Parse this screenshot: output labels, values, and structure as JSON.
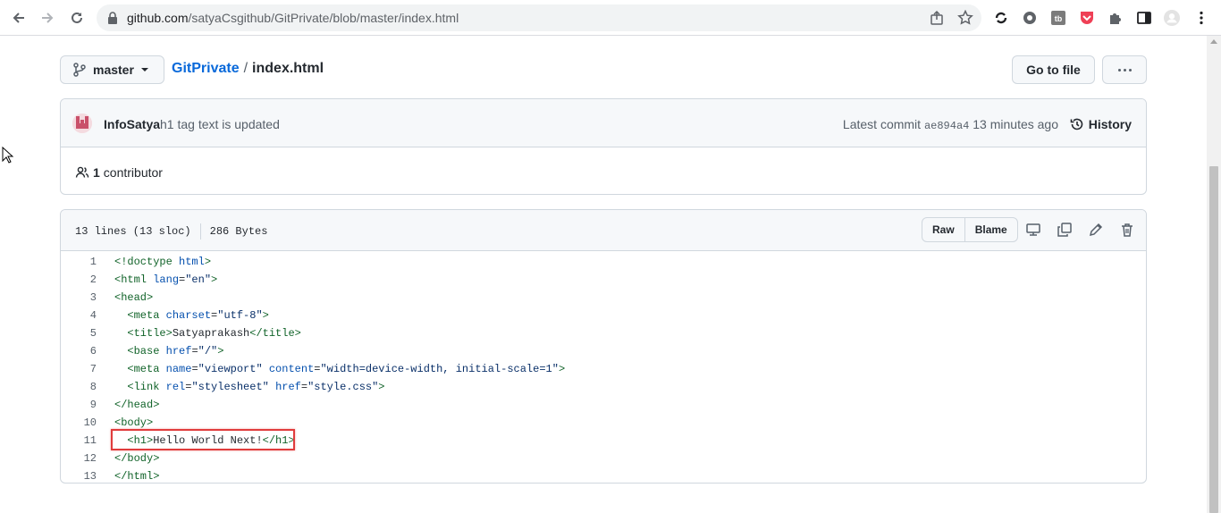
{
  "browser": {
    "url_host": "github.com",
    "url_path": "/satyaCsgithub/GitPrivate/blob/master/index.html"
  },
  "file_header": {
    "branch": "master",
    "repo": "GitPrivate",
    "separator": "/",
    "file_name": "index.html",
    "go_to_file_label": "Go to file"
  },
  "commit": {
    "author": "InfoSatya",
    "message": "h1 tag text is updated",
    "latest_label": "Latest commit",
    "sha": "ae894a4",
    "time": "13 minutes ago",
    "history_label": "History",
    "contributor_count": "1",
    "contributor_label": "contributor"
  },
  "file_info": {
    "lines": "13 lines (13 sloc)",
    "size": "286 Bytes",
    "raw_label": "Raw",
    "blame_label": "Blame"
  },
  "code_lines": [
    {
      "n": "1",
      "text": "<!doctype html>"
    },
    {
      "n": "2",
      "text": "<html lang=\"en\">"
    },
    {
      "n": "3",
      "text": "<head>"
    },
    {
      "n": "4",
      "text": "  <meta charset=\"utf-8\">"
    },
    {
      "n": "5",
      "text": "  <title>Satyaprakash</title>"
    },
    {
      "n": "6",
      "text": "  <base href=\"/\">"
    },
    {
      "n": "7",
      "text": "  <meta name=\"viewport\" content=\"width=device-width, initial-scale=1\">"
    },
    {
      "n": "8",
      "text": "  <link rel=\"stylesheet\" href=\"style.css\">"
    },
    {
      "n": "9",
      "text": "</head>"
    },
    {
      "n": "10",
      "text": "<body>"
    },
    {
      "n": "11",
      "text": "  <h1>Hello World Next!</h1>"
    },
    {
      "n": "12",
      "text": "</body>"
    },
    {
      "n": "13",
      "text": "</html>"
    }
  ],
  "highlighted_line": "11",
  "colors": {
    "link": "#0969da",
    "highlight_border": "#e03c3c",
    "tag": "#116329",
    "attr": "#0550ae",
    "string": "#0a3069"
  }
}
